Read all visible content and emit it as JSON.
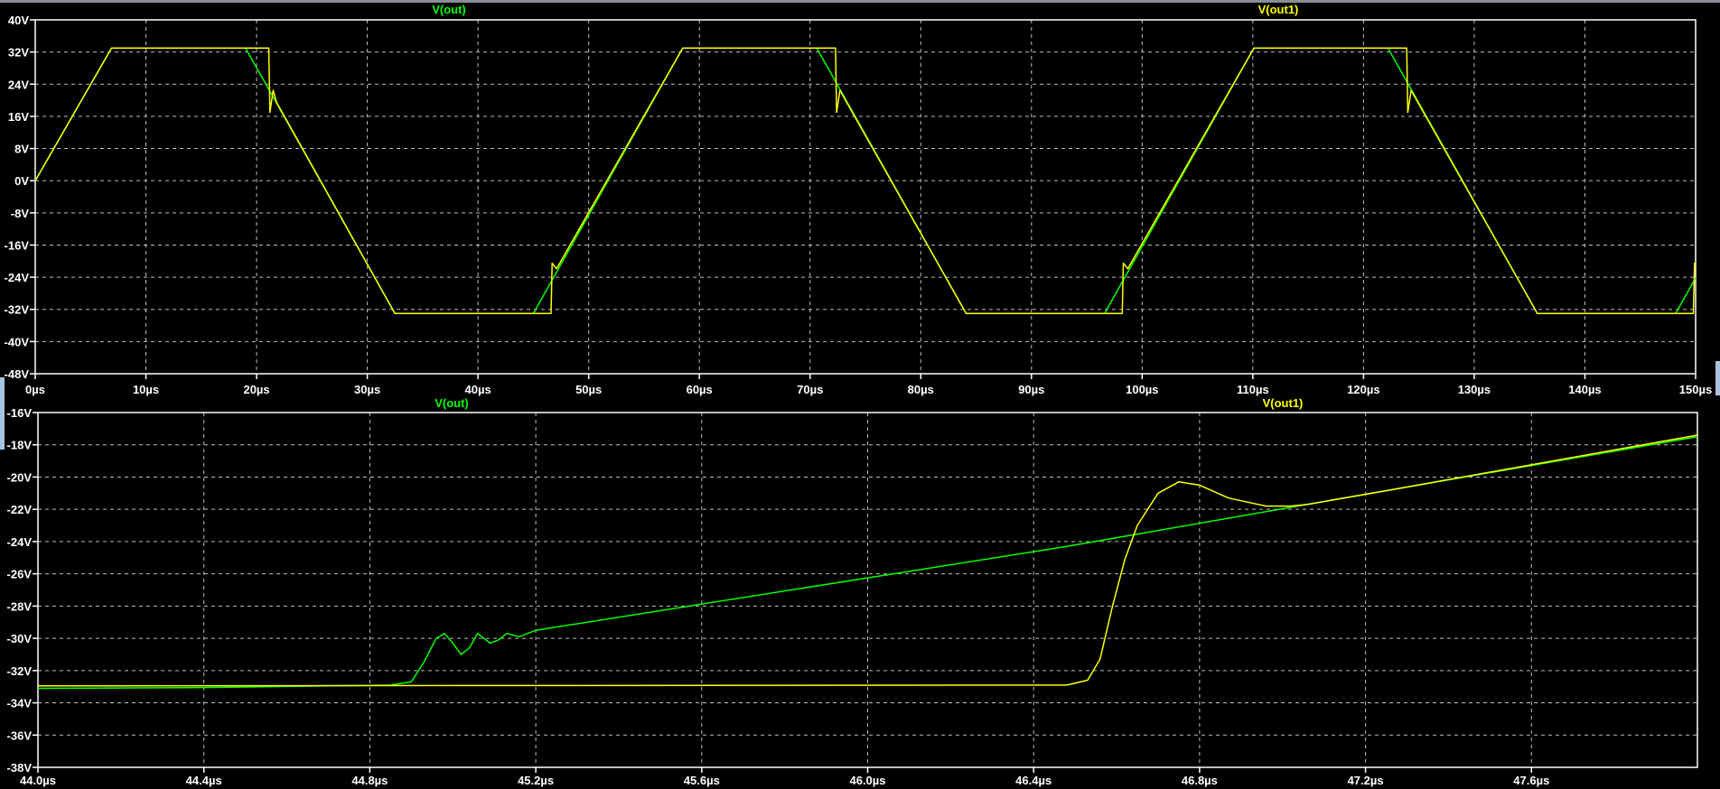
{
  "chart_data": [
    {
      "type": "line",
      "title": "",
      "xlabel": "",
      "ylabel": "",
      "xlim": [
        0,
        150
      ],
      "ylim": [
        -48,
        40
      ],
      "grid": true,
      "x_ticks": [
        0,
        10,
        20,
        30,
        40,
        50,
        60,
        70,
        80,
        90,
        100,
        110,
        120,
        130,
        140,
        150
      ],
      "x_tick_labels": [
        "0µs",
        "10µs",
        "20µs",
        "30µs",
        "40µs",
        "50µs",
        "60µs",
        "70µs",
        "80µs",
        "90µs",
        "100µs",
        "110µs",
        "120µs",
        "130µs",
        "140µs",
        "150µs"
      ],
      "y_ticks": [
        40,
        32,
        24,
        16,
        8,
        0,
        -8,
        -16,
        -24,
        -32,
        -40,
        -48
      ],
      "y_tick_labels": [
        "40V",
        "32V",
        "24V",
        "16V",
        "8V",
        "0V",
        "-8V",
        "-16V",
        "-24V",
        "-32V",
        "-40V",
        "-48V"
      ],
      "legend_placement": "top",
      "series": [
        {
          "name": "V(out)",
          "color": "#00ff00",
          "points": [
            [
              0,
              0
            ],
            [
              6.9,
              33
            ],
            [
              19,
              33
            ],
            [
              32.5,
              -33
            ],
            [
              45,
              -33
            ],
            [
              58.5,
              33
            ],
            [
              70.6,
              33
            ],
            [
              84.1,
              -33
            ],
            [
              96.6,
              -33
            ],
            [
              110.1,
              33
            ],
            [
              122.2,
              33
            ],
            [
              135.7,
              -33
            ],
            [
              148.2,
              -33
            ],
            [
              150,
              -24.2
            ]
          ]
        },
        {
          "name": "V(out1)",
          "color": "#ffff00",
          "points": [
            [
              0,
              0
            ],
            [
              6.9,
              33
            ],
            [
              21.1,
              33
            ],
            [
              21.2,
              17
            ],
            [
              21.5,
              22.5
            ],
            [
              21.8,
              19.5
            ],
            [
              32.5,
              -33
            ],
            [
              46.6,
              -33
            ],
            [
              46.7,
              -20.5
            ],
            [
              47.1,
              -21.9
            ],
            [
              58.5,
              33
            ],
            [
              72.3,
              33
            ],
            [
              72.4,
              17
            ],
            [
              72.7,
              22.5
            ],
            [
              73.1,
              20.5
            ],
            [
              84.1,
              -33
            ],
            [
              98.2,
              -33
            ],
            [
              98.3,
              -20.5
            ],
            [
              98.7,
              -21.9
            ],
            [
              110.1,
              33
            ],
            [
              123.9,
              33
            ],
            [
              124.0,
              17
            ],
            [
              124.3,
              22.5
            ],
            [
              124.7,
              20.5
            ],
            [
              135.7,
              -33
            ],
            [
              149.8,
              -33
            ],
            [
              149.9,
              -20.5
            ],
            [
              150,
              -21
            ]
          ]
        }
      ]
    },
    {
      "type": "line",
      "title": "",
      "xlabel": "",
      "ylabel": "",
      "xlim": [
        44.0,
        48.0
      ],
      "ylim": [
        -38,
        -16
      ],
      "grid": true,
      "x_ticks": [
        44.0,
        44.4,
        44.8,
        45.2,
        45.6,
        46.0,
        46.4,
        46.8,
        47.2,
        47.6
      ],
      "x_tick_labels": [
        "44.0µs",
        "44.4µs",
        "44.8µs",
        "45.2µs",
        "45.6µs",
        "46.0µs",
        "46.4µs",
        "46.8µs",
        "47.2µs",
        "47.6µs"
      ],
      "y_ticks": [
        -16,
        -18,
        -20,
        -22,
        -24,
        -26,
        -28,
        -30,
        -32,
        -34,
        -36,
        -38
      ],
      "y_tick_labels": [
        "-16V",
        "-18V",
        "-20V",
        "-22V",
        "-24V",
        "-26V",
        "-28V",
        "-30V",
        "-32V",
        "-34V",
        "-36V",
        "-38V"
      ],
      "legend_placement": "top",
      "series": [
        {
          "name": "V(out)",
          "color": "#00ff00",
          "points": [
            [
              44.0,
              -33.1
            ],
            [
              44.4,
              -33.05
            ],
            [
              44.85,
              -32.9
            ],
            [
              44.9,
              -32.7
            ],
            [
              44.93,
              -31.5
            ],
            [
              44.96,
              -30.0
            ],
            [
              44.98,
              -29.7
            ],
            [
              45.0,
              -30.3
            ],
            [
              45.02,
              -31.0
            ],
            [
              45.04,
              -30.6
            ],
            [
              45.06,
              -29.7
            ],
            [
              45.08,
              -30.1
            ],
            [
              45.09,
              -30.3
            ],
            [
              45.11,
              -30.1
            ],
            [
              45.13,
              -29.7
            ],
            [
              45.16,
              -29.9
            ],
            [
              45.2,
              -29.5
            ],
            [
              46.48,
              -24.3
            ],
            [
              47.26,
              -20.8
            ],
            [
              48.0,
              -17.5
            ]
          ]
        },
        {
          "name": "V(out1)",
          "color": "#ffff00",
          "points": [
            [
              44.0,
              -32.95
            ],
            [
              46.48,
              -32.9
            ],
            [
              46.53,
              -32.6
            ],
            [
              46.56,
              -31.3
            ],
            [
              46.59,
              -28.0
            ],
            [
              46.62,
              -25.1
            ],
            [
              46.65,
              -23.0
            ],
            [
              46.7,
              -21.0
            ],
            [
              46.75,
              -20.3
            ],
            [
              46.8,
              -20.5
            ],
            [
              46.87,
              -21.3
            ],
            [
              46.96,
              -21.8
            ],
            [
              47.02,
              -21.8
            ],
            [
              47.06,
              -21.7
            ],
            [
              47.26,
              -20.8
            ],
            [
              48.0,
              -17.4
            ]
          ]
        }
      ]
    }
  ]
}
